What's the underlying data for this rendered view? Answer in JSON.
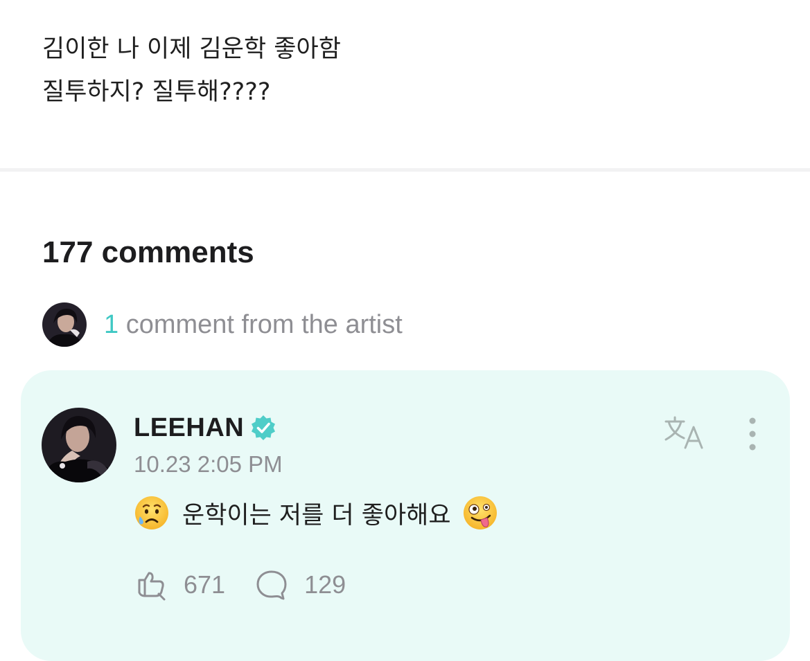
{
  "post": {
    "line1": "김이한 나 이제 김운학 좋아함",
    "line2": "질투하지? 질투해????"
  },
  "comments": {
    "count_label": "177 comments"
  },
  "artist_comments": {
    "count": "1",
    "label": " comment from the artist"
  },
  "comment": {
    "author": "LEEHAN",
    "timestamp": "10.23 2:05 PM",
    "text": "운학이는 저를 더 좋아해요",
    "leading_emoji": "sad-but-relieved-emoji",
    "trailing_emoji": "zany-face-emoji",
    "likes": "671",
    "replies": "129"
  },
  "colors": {
    "accent": "#3fc8c4",
    "card_background": "#e9faf7",
    "muted_text": "#8e8e93",
    "icon_gray": "#a9b4b2"
  },
  "icons": {
    "verified": "verified-badge-icon",
    "translate": "translate-icon",
    "more": "more-vertical-icon",
    "like": "like-reaction-icon",
    "reply": "reply-bubble-icon"
  }
}
